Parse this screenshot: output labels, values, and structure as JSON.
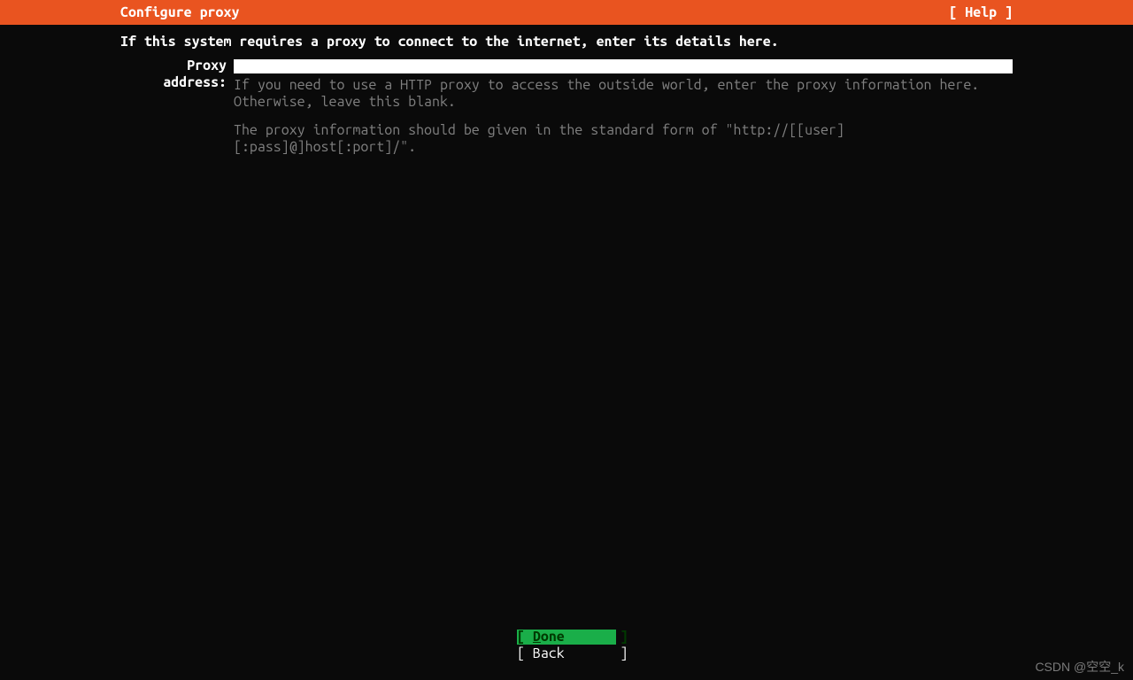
{
  "header": {
    "title": "Configure proxy",
    "help": "[ Help ]"
  },
  "intro": "If this system requires a proxy to connect to the internet, enter its details here.",
  "form": {
    "proxy_label": "Proxy address:",
    "proxy_value": "",
    "hint1": "If you need to use a HTTP proxy to access the outside world, enter the proxy information here. Otherwise, leave this blank.",
    "hint2": "The proxy information should be given in the standard form of \"http://[[user][:pass]@]host[:port]/\"."
  },
  "buttons": {
    "done_open": "[ ",
    "done_key": "D",
    "done_rest": "one",
    "done_close": "       ]",
    "back_open": "[ ",
    "back_key": "B",
    "back_rest": "ack",
    "back_close": "       ]"
  },
  "watermark": "CSDN @空空_k"
}
